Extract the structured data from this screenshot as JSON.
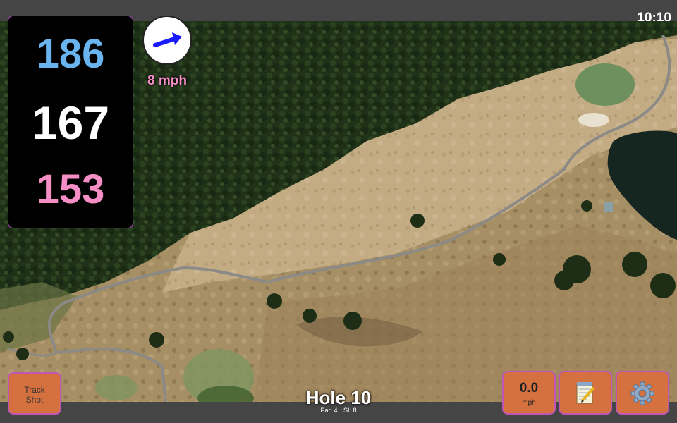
{
  "status_bar": {
    "time": "10:10"
  },
  "distances": {
    "back": "186",
    "middle": "167",
    "front": "153"
  },
  "wind": {
    "speed_text": "8 mph",
    "direction_icon": "arrow-icon"
  },
  "buttons": {
    "track_shot_line1": "Track",
    "track_shot_line2": "Shot",
    "speed_value": "0.0",
    "speed_unit": "mph",
    "notes_icon": "notepad-icon",
    "settings_icon": "gear-icon"
  },
  "hole": {
    "title": "Hole 10",
    "par": "Par: 4",
    "si": "SI: 8"
  },
  "colors": {
    "back": "#69b4ef",
    "middle": "#ffffff",
    "front": "#f58ec5",
    "button": "#d5713f",
    "accent": "#c046c8"
  }
}
